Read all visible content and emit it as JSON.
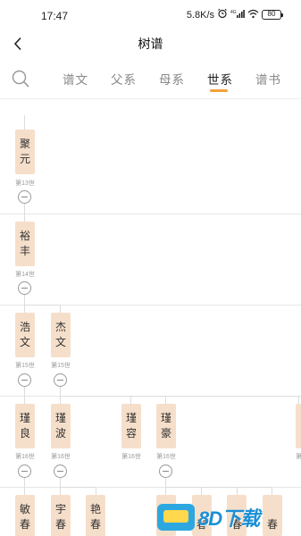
{
  "status": {
    "time": "17:47",
    "speed": "5.8K/s",
    "network": "4G",
    "battery": "80"
  },
  "header": {
    "title": "树谱"
  },
  "tabs": [
    {
      "label": "谱文",
      "active": false
    },
    {
      "label": "父系",
      "active": false
    },
    {
      "label": "母系",
      "active": false
    },
    {
      "label": "世系",
      "active": true
    },
    {
      "label": "谱书",
      "active": false
    }
  ],
  "accent_color": "#f1a23a",
  "node_color": "#f6dfca",
  "tree": {
    "gen13": {
      "nodes": [
        {
          "name": "聚元",
          "gen": "第13世"
        }
      ]
    },
    "gen14": {
      "nodes": [
        {
          "name": "裕丰",
          "gen": "第14世"
        }
      ]
    },
    "gen15": {
      "nodes": [
        {
          "name": "浩文",
          "gen": "第15世"
        },
        {
          "name": "杰文",
          "gen": "第15世"
        }
      ]
    },
    "gen16": {
      "nodes": [
        {
          "name": "瑾良",
          "gen": "第16世"
        },
        {
          "name": "瑾波",
          "gen": "第16世"
        },
        {
          "name": "瑾容",
          "gen": "第16世"
        },
        {
          "name": "瑾豪",
          "gen": "第16世"
        },
        {
          "name": "瑾",
          "gen": "第"
        }
      ]
    },
    "gen17": {
      "nodes": [
        {
          "name": "敏春"
        },
        {
          "name": "宇春"
        },
        {
          "name": "艳春"
        },
        {
          "name": ""
        },
        {
          "name": "春"
        },
        {
          "name": "春"
        },
        {
          "name": "春"
        }
      ]
    }
  },
  "watermark": {
    "text": "8D下载"
  }
}
